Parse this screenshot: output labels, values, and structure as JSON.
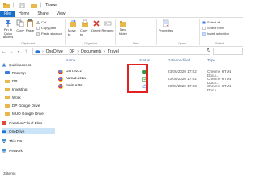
{
  "window": {
    "title": "Travel"
  },
  "ribbon_tabs": [
    "File",
    "Home",
    "Share",
    "View"
  ],
  "ribbon": {
    "pin_label": "Pin to Quick access",
    "copy_label": "Copy",
    "paste_label": "Paste",
    "cut_label": "Cut",
    "copy_path_label": "Copy path",
    "paste_shortcut_label": "Paste shortcut",
    "clipboard_group": "Clipboard",
    "move_to_label": "Move to",
    "copy_to_label": "Copy to",
    "delete_label": "Delete",
    "rename_label": "Rename",
    "organize_group": "Organize",
    "new_folder_label": "New folder",
    "new_group": "New",
    "properties_label": "Properties",
    "open_group": "Open",
    "select_all_label": "Select all",
    "select_none_label": "Select none",
    "invert_selection_label": "Invert selection",
    "select_group": "Select"
  },
  "address": {
    "crumbs": [
      "OneDrive",
      "DP",
      "Documents",
      "Travel"
    ]
  },
  "nav": {
    "items": [
      {
        "label": "Quick access",
        "color": "#3b7ddd"
      },
      {
        "label": "Desktop",
        "color": "#3b7ddd"
      },
      {
        "label": "DP",
        "color": "#e8b84a"
      },
      {
        "label": "Investing",
        "color": "#e8b84a"
      },
      {
        "label": "Work",
        "color": "#e8b84a"
      },
      {
        "label": "DP Google Drive",
        "color": "#e8b84a"
      },
      {
        "label": "MUO Google Drive",
        "color": "#e8b84a"
      },
      {
        "label": "Creative Cloud Files",
        "color": "#e04a3a"
      },
      {
        "label": "OneDrive",
        "color": "#1e73d8"
      },
      {
        "label": "This PC",
        "color": "#4a90d9"
      },
      {
        "label": "Network",
        "color": "#4a90d9"
      }
    ]
  },
  "columns": {
    "name": "Name",
    "status": "Status",
    "date": "Date modified",
    "type": "Type"
  },
  "files": [
    {
      "name": "Dan.ezzz",
      "status": "green-circle",
      "date": "23/06/2020 17:02",
      "type": "Chrome HTML Docu..."
    },
    {
      "name": "hamat.ezza",
      "status": "green-check",
      "date": "23/06/2020 17:02",
      "type": "Chrome HTML Docu..."
    },
    {
      "name": "muin.ezts",
      "status": "cloud",
      "date": "23/06/2020 17:03",
      "type": "Chrome HTML Docu..."
    }
  ],
  "status_bar": {
    "count": "3 items"
  }
}
